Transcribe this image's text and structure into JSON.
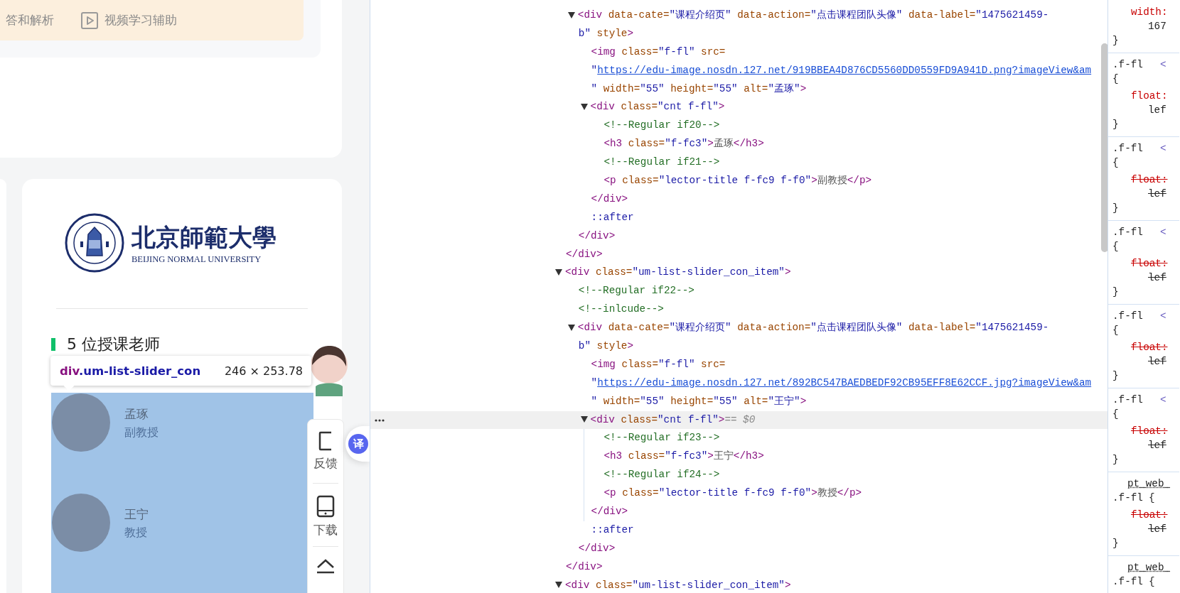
{
  "page": {
    "banner": {
      "items": [
        {
          "kind": "text",
          "label": "答和解析"
        },
        {
          "kind": "video",
          "label": "视频学习辅助"
        }
      ]
    },
    "logo": {
      "name": "北京師範大學",
      "name_en": "BEIJING NORMAL UNIVERSITY"
    },
    "teachers_heading": "5 位授课老师",
    "teachers": [
      {
        "name": "孟琢",
        "title": "副教授"
      },
      {
        "name": "王宁",
        "title": "教授"
      }
    ]
  },
  "inspect_tooltip": {
    "tag": "div",
    "class": ".um-list-slider_con",
    "size": "246 × 253.78"
  },
  "side_toolbar": {
    "items": [
      {
        "kind": "feedback",
        "label": "反馈"
      },
      {
        "kind": "download",
        "label": "下载"
      },
      {
        "kind": "top"
      }
    ]
  },
  "translate_button": {
    "label": "译"
  },
  "elements": {
    "selection_marker": "== $0",
    "nodes": [
      {
        "closing": [
          {
            "kind": "tag",
            "text": "</div>"
          }
        ],
        "children": [
          {
            "selected": false,
            "expanded": true,
            "lines": [
              [
                {
                  "kind": "tag",
                  "text": "<div"
                },
                {
                  "kind": "attr",
                  "text": " data-cate="
                },
                {
                  "kind": "val",
                  "text": "\"课程介绍页\""
                },
                {
                  "kind": "attr",
                  "text": " data-action="
                },
                {
                  "kind": "val",
                  "text": "\"点击课程团队头像\""
                },
                {
                  "kind": "attr",
                  "text": " data-label="
                },
                {
                  "kind": "val",
                  "text": "\"1475621459-"
                }
              ],
              [
                {
                  "kind": "val",
                  "text": "b\""
                },
                {
                  "kind": "attr",
                  "text": " style"
                },
                {
                  "kind": "tag",
                  "text": ">"
                }
              ]
            ],
            "closing": [
              {
                "kind": "tag",
                "text": "</div>"
              }
            ],
            "children": [
              {
                "selected": false,
                "lines": [
                  [
                    {
                      "kind": "tag",
                      "text": "<img"
                    },
                    {
                      "kind": "attr",
                      "text": " class="
                    },
                    {
                      "kind": "val",
                      "text": "\"f-fl\""
                    },
                    {
                      "kind": "attr",
                      "text": " src="
                    }
                  ],
                  [
                    {
                      "kind": "val",
                      "text": "\""
                    },
                    {
                      "kind": "link",
                      "text": "https://edu-image.nosdn.127.net/919BBEA4D876CD5560DD0559FD9A941D.png?imageView&am"
                    }
                  ],
                  [
                    {
                      "kind": "val",
                      "text": "\""
                    },
                    {
                      "kind": "attr",
                      "text": " width="
                    },
                    {
                      "kind": "val",
                      "text": "\"55\""
                    },
                    {
                      "kind": "attr",
                      "text": " height="
                    },
                    {
                      "kind": "val",
                      "text": "\"55\""
                    },
                    {
                      "kind": "attr",
                      "text": " alt="
                    },
                    {
                      "kind": "val",
                      "text": "\"孟琢\""
                    },
                    {
                      "kind": "tag",
                      "text": ">"
                    }
                  ]
                ]
              },
              {
                "selected": false,
                "expanded": true,
                "lines": [
                  [
                    {
                      "kind": "tag",
                      "text": "<div"
                    },
                    {
                      "kind": "attr",
                      "text": " class="
                    },
                    {
                      "kind": "val",
                      "text": "\"cnt f-fl\""
                    },
                    {
                      "kind": "tag",
                      "text": ">"
                    }
                  ]
                ],
                "closing": [
                  {
                    "kind": "tag",
                    "text": "</div>"
                  }
                ],
                "children": [
                  {
                    "selected": false,
                    "lines": [
                      [
                        {
                          "kind": "comment",
                          "text": "<!--Regular if20-->"
                        }
                      ]
                    ]
                  },
                  {
                    "selected": false,
                    "lines": [
                      [
                        {
                          "kind": "tag",
                          "text": "<h3"
                        },
                        {
                          "kind": "attr",
                          "text": " class="
                        },
                        {
                          "kind": "val",
                          "text": "\"f-fc3\""
                        },
                        {
                          "kind": "tag",
                          "text": ">"
                        },
                        {
                          "kind": "text",
                          "text": "孟琢"
                        },
                        {
                          "kind": "tag",
                          "text": "</h3>"
                        }
                      ]
                    ]
                  },
                  {
                    "selected": false,
                    "lines": [
                      [
                        {
                          "kind": "comment",
                          "text": "<!--Regular if21-->"
                        }
                      ]
                    ]
                  },
                  {
                    "selected": false,
                    "lines": [
                      [
                        {
                          "kind": "tag",
                          "text": "<p"
                        },
                        {
                          "kind": "attr",
                          "text": " class="
                        },
                        {
                          "kind": "val",
                          "text": "\"lector-title f-fc9 f-f0\""
                        },
                        {
                          "kind": "tag",
                          "text": ">"
                        },
                        {
                          "kind": "text",
                          "text": "副教授"
                        },
                        {
                          "kind": "tag",
                          "text": "</p>"
                        }
                      ]
                    ]
                  }
                ]
              },
              {
                "selected": false,
                "lines": [
                  [
                    {
                      "kind": "pseudo",
                      "text": "::after"
                    }
                  ]
                ]
              }
            ]
          }
        ]
      },
      {
        "selected": false,
        "expanded": true,
        "lines": [
          [
            {
              "kind": "tag",
              "text": "<div"
            },
            {
              "kind": "attr",
              "text": " class="
            },
            {
              "kind": "val",
              "text": "\"um-list-slider_con_item\""
            },
            {
              "kind": "tag",
              "text": ">"
            }
          ]
        ],
        "closing": [
          {
            "kind": "tag",
            "text": "</div>"
          }
        ],
        "children": [
          {
            "selected": false,
            "lines": [
              [
                {
                  "kind": "comment",
                  "text": "<!--Regular if22-->"
                }
              ]
            ]
          },
          {
            "selected": false,
            "lines": [
              [
                {
                  "kind": "comment",
                  "text": "<!--inlcude-->"
                }
              ]
            ]
          },
          {
            "selected": false,
            "expanded": true,
            "lines": [
              [
                {
                  "kind": "tag",
                  "text": "<div"
                },
                {
                  "kind": "attr",
                  "text": " data-cate="
                },
                {
                  "kind": "val",
                  "text": "\"课程介绍页\""
                },
                {
                  "kind": "attr",
                  "text": " data-action="
                },
                {
                  "kind": "val",
                  "text": "\"点击课程团队头像\""
                },
                {
                  "kind": "attr",
                  "text": " data-label="
                },
                {
                  "kind": "val",
                  "text": "\"1475621459-"
                }
              ],
              [
                {
                  "kind": "val",
                  "text": "b\""
                },
                {
                  "kind": "attr",
                  "text": " style"
                },
                {
                  "kind": "tag",
                  "text": ">"
                }
              ]
            ],
            "closing": [
              {
                "kind": "tag",
                "text": "</div>"
              }
            ],
            "children": [
              {
                "selected": false,
                "lines": [
                  [
                    {
                      "kind": "tag",
                      "text": "<img"
                    },
                    {
                      "kind": "attr",
                      "text": " class="
                    },
                    {
                      "kind": "val",
                      "text": "\"f-fl\""
                    },
                    {
                      "kind": "attr",
                      "text": " src="
                    }
                  ],
                  [
                    {
                      "kind": "val",
                      "text": "\""
                    },
                    {
                      "kind": "link",
                      "text": "https://edu-image.nosdn.127.net/892BC547BAEDBEDF92CB95EFF8E62CCF.jpg?imageView&am"
                    }
                  ],
                  [
                    {
                      "kind": "val",
                      "text": "\""
                    },
                    {
                      "kind": "attr",
                      "text": " width="
                    },
                    {
                      "kind": "val",
                      "text": "\"55\""
                    },
                    {
                      "kind": "attr",
                      "text": " height="
                    },
                    {
                      "kind": "val",
                      "text": "\"55\""
                    },
                    {
                      "kind": "attr",
                      "text": " alt="
                    },
                    {
                      "kind": "val",
                      "text": "\"王宁\""
                    },
                    {
                      "kind": "tag",
                      "text": ">"
                    }
                  ]
                ]
              },
              {
                "selected": true,
                "expanded": true,
                "lines": [
                  [
                    {
                      "kind": "tag",
                      "text": "<div"
                    },
                    {
                      "kind": "attr",
                      "text": " class="
                    },
                    {
                      "kind": "val",
                      "text": "\"cnt f-fl\""
                    },
                    {
                      "kind": "tag",
                      "text": ">"
                    }
                  ]
                ],
                "closing": [
                  {
                    "kind": "tag",
                    "text": "</div>"
                  }
                ],
                "children": [
                  {
                    "selected": false,
                    "lines": [
                      [
                        {
                          "kind": "comment",
                          "text": "<!--Regular if23-->"
                        }
                      ]
                    ]
                  },
                  {
                    "selected": false,
                    "lines": [
                      [
                        {
                          "kind": "tag",
                          "text": "<h3"
                        },
                        {
                          "kind": "attr",
                          "text": " class="
                        },
                        {
                          "kind": "val",
                          "text": "\"f-fc3\""
                        },
                        {
                          "kind": "tag",
                          "text": ">"
                        },
                        {
                          "kind": "text",
                          "text": "王宁"
                        },
                        {
                          "kind": "tag",
                          "text": "</h3>"
                        }
                      ]
                    ]
                  },
                  {
                    "selected": false,
                    "lines": [
                      [
                        {
                          "kind": "comment",
                          "text": "<!--Regular if24-->"
                        }
                      ]
                    ]
                  },
                  {
                    "selected": false,
                    "lines": [
                      [
                        {
                          "kind": "tag",
                          "text": "<p"
                        },
                        {
                          "kind": "attr",
                          "text": " class="
                        },
                        {
                          "kind": "val",
                          "text": "\"lector-title f-fc9 f-f0\""
                        },
                        {
                          "kind": "tag",
                          "text": ">"
                        },
                        {
                          "kind": "text",
                          "text": "教授"
                        },
                        {
                          "kind": "tag",
                          "text": "</p>"
                        }
                      ]
                    ]
                  }
                ]
              },
              {
                "selected": false,
                "lines": [
                  [
                    {
                      "kind": "pseudo",
                      "text": "::after"
                    }
                  ]
                ]
              }
            ]
          }
        ]
      },
      {
        "selected": false,
        "expanded": true,
        "lines": [
          [
            {
              "kind": "tag",
              "text": "<div"
            },
            {
              "kind": "attr",
              "text": " class="
            },
            {
              "kind": "val",
              "text": "\"um-list-slider_con_item\""
            },
            {
              "kind": "tag",
              "text": ">"
            }
          ]
        ]
      }
    ]
  },
  "styles": {
    "rules": [
      {
        "props": [
          {
            "name": "width:",
            "value": "167",
            "overridden": false
          }
        ],
        "close": "}"
      },
      {
        "selector": ".f-fl",
        "source": "<",
        "open": "{",
        "props": [
          {
            "name": "float:",
            "value": "lef",
            "overridden": false
          }
        ],
        "close": "}"
      },
      {
        "selector": ".f-fl",
        "source": "<",
        "open": "{",
        "props": [
          {
            "name": "float:",
            "value": "lef",
            "overridden": true
          }
        ],
        "close": "}"
      },
      {
        "selector": ".f-fl",
        "source": "<",
        "open": "{",
        "props": [
          {
            "name": "float:",
            "value": "lef",
            "overridden": true
          }
        ],
        "close": "}"
      },
      {
        "selector": ".f-fl",
        "source": "<",
        "open": "{",
        "props": [
          {
            "name": "float:",
            "value": "lef",
            "overridden": true
          }
        ],
        "close": "}"
      },
      {
        "selector": ".f-fl",
        "source": "<",
        "open": "{",
        "props": [
          {
            "name": "float:",
            "value": "lef",
            "overridden": true
          }
        ],
        "close": "}"
      },
      {
        "scope": "pt_web_",
        "selector": ".f-fl",
        "open": "{",
        "props": [
          {
            "name": "float:",
            "value": "lef",
            "overridden": true
          }
        ],
        "close": "}"
      },
      {
        "scope": "pt_web_",
        "selector": ".f-fl",
        "open": "{"
      }
    ]
  }
}
